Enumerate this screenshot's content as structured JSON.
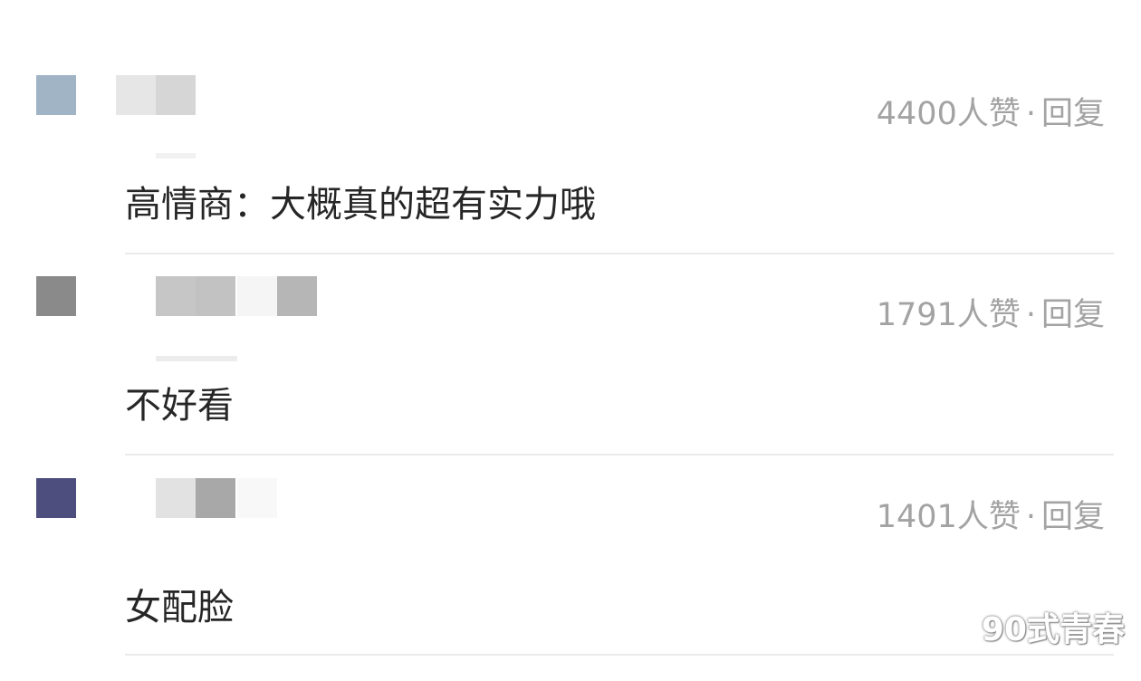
{
  "comments": [
    {
      "likes_text": "4400人赞",
      "separator": "·",
      "reply_label": "回复",
      "text": "高情商：大概真的超有实力哦",
      "avatar_color": "#a0b4c6",
      "name_blur_colors": [
        "#e6e6e6",
        "#d6d6d6"
      ]
    },
    {
      "likes_text": "1791人赞",
      "separator": "·",
      "reply_label": "回复",
      "text": "不好看",
      "avatar_color": "#8a8a8a",
      "name_blur_colors": [
        "#c6c6c6",
        "#c2c2c2",
        "#f5f5f5",
        "#b6b6b6"
      ]
    },
    {
      "likes_text": "1401人赞",
      "separator": "·",
      "reply_label": "回复",
      "text": "女配脸",
      "avatar_color": "#4d4d7e",
      "name_blur_colors": [
        "#e2e2e2",
        "#a8a8a8",
        "#f8f8f8"
      ]
    }
  ],
  "watermark": "90式青春"
}
